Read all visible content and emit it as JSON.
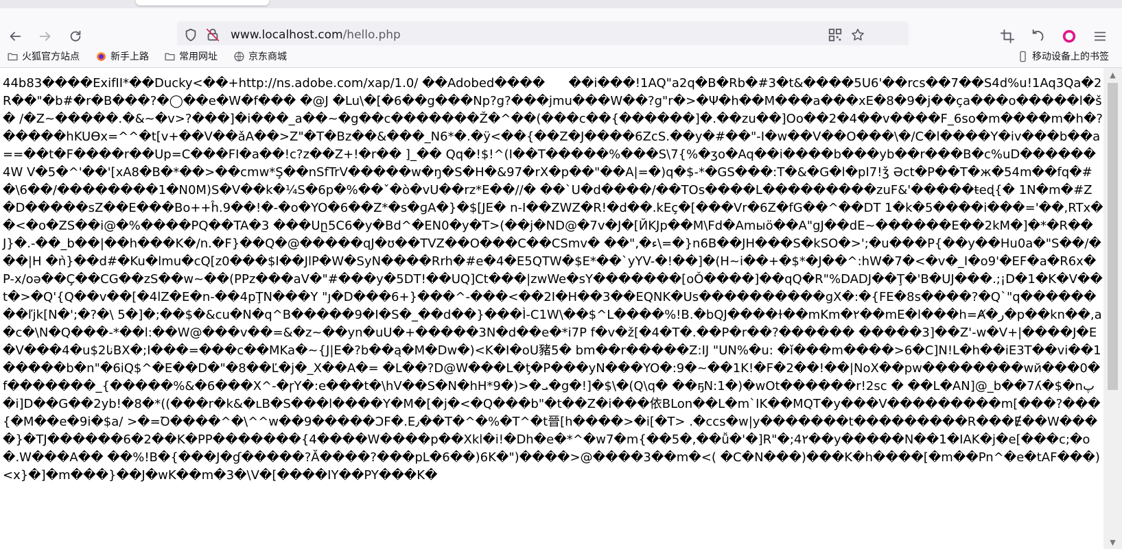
{
  "browser": {
    "url_host": "www.localhost.com",
    "url_path": "/hello.php"
  },
  "bookmarks": [
    {
      "label": "火狐官方站点",
      "icon": "folder-icon"
    },
    {
      "label": "新手上路",
      "icon": "firefox-icon"
    },
    {
      "label": "常用网址",
      "icon": "folder-icon"
    },
    {
      "label": "京东商城",
      "icon": "globe-icon"
    }
  ],
  "mobile_bookmarks": "移动设备上的书签",
  "content_text": "44b83����ExifII*��Ducky<��+http://ns.adobe.com/xap/1.0/ ��Adobed����      ��i���!1AQ\"a2q�B�Rb�#3�t&����5U6'��rcs��7��S4d%u!1Aq3Qa�2R��\"�b#�r�B���?�◯��e�W�f��� �@J �Lu\\�[�6��g���Np?g?���jmu���W��?g\"r�>�Ψ�h��M���a���xE�8�9�j��ça���o�����l�š� /�Z~�����.�&~�v>?���]�i���_a��~�g��c�������Ž�^��(���c��{������]�.��zu��]Oo��2�4��v����F_6so�m����m�h�?�����hKUӨx=^^�t[v+��V��ǎA��>Z\"�T�Bz��&���_N6*�.�ÿ<��{��Z�J����6ZcS.��y�#��\"-I�w��V��O���\\�/C�l����Y�iv���b��a==��t�F����r��Up=C���FI�a��!c?z��Z+!�r�� ]_�� Qq�!$!^(I��T�����%���S\\7{%�ʒo�Aq��i����b���yb��r���B�c%uD������4W V�5�^'��'[xA8�B�*��>��cmw*Ş��nSfTrV�����w�ŋ�S�H�&97�rX�p��\"��A|=�)q�$-*�GS���:T�&�G�l�pI7!ǯ Əct�P��T�ж�54m��fq�#�\\6��/��������1�N0M)S�V��k�¼S�6p�%��ˇ�ò�vU��rz*E��//� ��`U�d����/��TOs����L���������zuF&'�����ŧeɖ{� 1N�m�#Z�D�����sZ��E���Bo++ĥ.9��!�-�o�YO�6��Z*�s�ɡA�}�$[JE� n-I��ZWZ�R!�d��.kEç�[���Vr�6Z�fG��^��DT 1�k�5����i���='��,RTx��<�o�ZS��i@�%����PQ��TA�3 ���Uը5C6�y�Bd^�EN0�y�T>(��j�ND@�7v�J�[ЙKJp��M\\Fd�Amыö��A\"gJ��dE~������E��2kM�]�*�R��J}�.-��_b��|��h���K�/n.�F}��Q�@�����qJ�ʊ��TVZ��O���C��CSmv� ��\",�ء\\=�}n6B��JH���S�kSO�>';�u���P{��y��Hu0a�\"S��/���|H �ǹ}��d#�Ku�lmu�cQ[z0���$I��JlP�W�SyN����Rrh�#e�4�E5QTW�$E*��`yYV-�!��]�(H~i��+�$*�J��^:hW�7�<�v�_I�o9'�EF�a�R6x�P-x/oə��Ç��CG��zS��w~��(PPz���aV�\"#���y�5DT!��UQ]Ct���|zwWe�sY�������[oǑ����]��qQ�R\"%DADJ��Ţ�'B�UJ���.;¡D�1�K�V��t�>�Q'{Q��v��[�4lZ�E�n-��4pŢN���Y \"ȷ�D���6+}���^-���<��2I�H��3��EQNK�Us����������gX�:�{FE�8s����?�Q`\"q��������ľjk[N�';�?�\\ 5�]�;��$�&cu�N�q^B�����9�I�S�_��d��}���Ì-C1W\\��$^L����%!B.�bQJ����ɫ��mKm�٢��mE�l���h=Ⱥ�ر�p��kn��,a�c�\\N�Q���-*��l:��W@���v��=&�z~��yn�uU�+�����3N�d��e�*i7P f�v�ž[�4�T�.��P�r��?������ �����3]��Z'-w�V+|����J�E�V���4�u$2ناBX�;I���=���c��MKa�~{J|E�?b��ą�M�Dw�)<K�I�oU豬5� bm��r�����Z:IJ \"UN%�u: �ǐ���m����>6�C]N!L�h��iE3T��vi��1�����b�n\"�6iQ$^�E��D�\"�8��Ľ�j�_X��A�= �L��?D@W���L�ƫ�P���yN���YO�:9�~��1K!�F�2��!��|NoX��pw��������wй���0�f�������_{�����%&�6���X^-�ɼY�:e���t�\\hV��S�N�hH*9�)>�ܝ�g�!]�$\\�(Q\\q� ��ҕN:1�)�wOt������r!2sc � ��L�AN]@_b��7ʎ�$�nپ�i]D��G��2yb!�8�*((���r�k&�ʟB�S���l����Y�M�[�j�<�Q���b\"�t��Z�i���依BLon��L�m`IK��MQT�y���V���������m[���?���{�M��e�9i�$a/ >�=Ꝺ����^�\\^^w��9�����ƆF�.E٫��T�^�%�T^�t晉[h����>�i[�T> .�ccs�w|y�������t���������R���Ɇ��W����}�TJ������6�2��K�PP�������{4����W����p��Xkl�i!�Dh�e�*^�w7�m{��5�,��ǚ�'�]R\"�;4۲��y�����N��1�IAK�j�e[���c;�o�.W���A�� ��%!B�{���J�ɠ�����?Ă����?���pL�6��)6K�\")����>@����3��m�<( �C�N���)���K�h����[�m��Pn^�e�tAF���)<x}�]�m���}��J�wK��m�3�\\V�[����IΥ��PY���K�"
}
